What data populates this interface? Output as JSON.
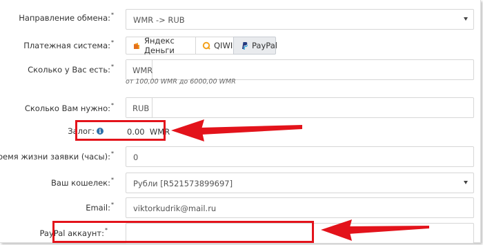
{
  "direction": {
    "label": "Направление обмена:",
    "value": "WMR -> RUB"
  },
  "payment": {
    "label": "Платежная система:",
    "options": [
      {
        "label": "Яндекс Деньги",
        "icon": "yandex-money-icon"
      },
      {
        "label": "QIWI",
        "icon": "qiwi-icon"
      },
      {
        "label": "PayPal",
        "icon": "paypal-icon",
        "active": true
      }
    ]
  },
  "have": {
    "label": "Сколько у Вас есть:",
    "currency": "WMR",
    "hint": "от 100,00 WMR до 6000,00 WMR"
  },
  "need": {
    "label": "Сколько Вам нужно:",
    "currency": "RUB"
  },
  "deposit": {
    "label": "Залог:",
    "value": "0.00",
    "currency": "WMR"
  },
  "lifetime": {
    "label": "Время жизни заявки (часы):",
    "value": "0"
  },
  "wallet": {
    "label": "Ваш кошелек:",
    "value": "Рубли [R521573899697]"
  },
  "email": {
    "label": "Email:",
    "value": "viktorkudrik@mail.ru"
  },
  "paypal": {
    "label": "PayPal аккаунт:",
    "value": ""
  },
  "required_mark": "*",
  "colors": {
    "annotation_red": "#e3131b",
    "active_tab": "#e9ebee",
    "info_icon": "#2d6fa8"
  }
}
